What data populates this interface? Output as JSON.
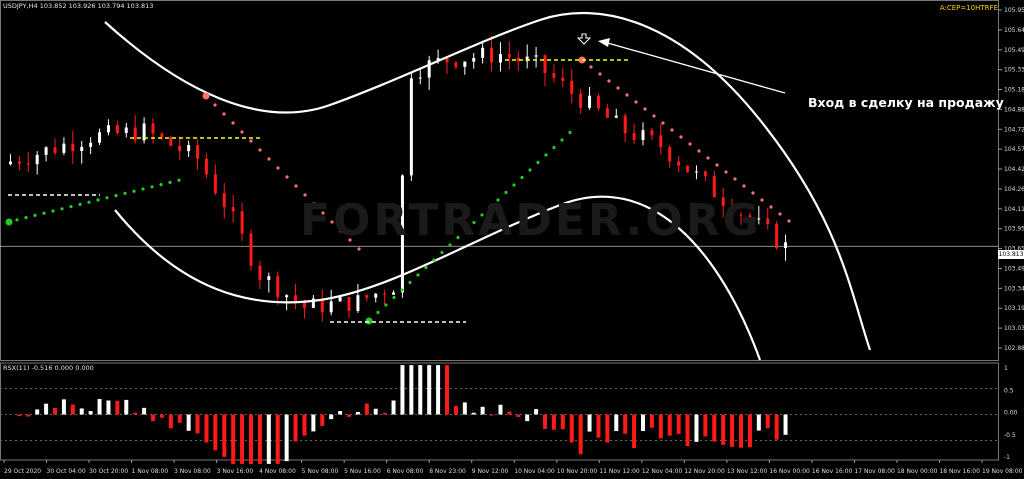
{
  "header": {
    "symbol_info": "USDJPY,H4  103.852 103.926 103.794 103.813",
    "corner_label": "A:CEP=10HTRFE",
    "annotation": "Вход в сделку на продажу",
    "indicator_label": "RSX(11) -0.516 0.000 0.000",
    "current_price": "103.813",
    "watermark": "FORTRADER.ORG"
  },
  "colors": {
    "bull": "#ffffff",
    "bear": "#ff1a1a",
    "sar_up": "#22cc22",
    "sar_down": "#ff7070",
    "level_line": "#ffff00",
    "background": "#000000"
  },
  "chart_data": [
    {
      "type": "candlestick",
      "title": "USDJPY,H4",
      "ylim": [
        102.88,
        105.95
      ],
      "y_ticks": [
        "105.950",
        "105.645",
        "105.490",
        "105.335",
        "105.180",
        "104.880",
        "104.725",
        "104.570",
        "104.420",
        "104.265",
        "104.110",
        "103.955",
        "103.650",
        "103.495",
        "103.340",
        "103.190",
        "103.035",
        "102.880"
      ],
      "x_ticks": [
        "29 Oct 2020",
        "30 Oct 04:00",
        "30 Oct 20:00",
        "1 Nov 08:00",
        "3 Nov 08:00",
        "3 Nov 16:00",
        "4 Nov 08:00",
        "5 Nov 08:00",
        "5 Nov 16:00",
        "6 Nov 08:00",
        "8 Nov 23:00",
        "9 Nov 12:00",
        "10 Nov 04:00",
        "10 Nov 20:00",
        "11 Nov 12:00",
        "12 Nov 04:00",
        "12 Nov 20:00",
        "13 Nov 12:00",
        "16 Nov 00:00",
        "16 Nov 16:00",
        "17 Nov 08:00",
        "18 Nov 00:00",
        "18 Nov 16:00",
        "19 Nov 08:00"
      ],
      "current_price": 103.813
    },
    {
      "type": "bar",
      "title": "RSX(11)",
      "ylim": [
        -1,
        1
      ],
      "y_ticks": [
        "1",
        "0.5",
        "0.00",
        "-0.5",
        "-1"
      ]
    }
  ]
}
